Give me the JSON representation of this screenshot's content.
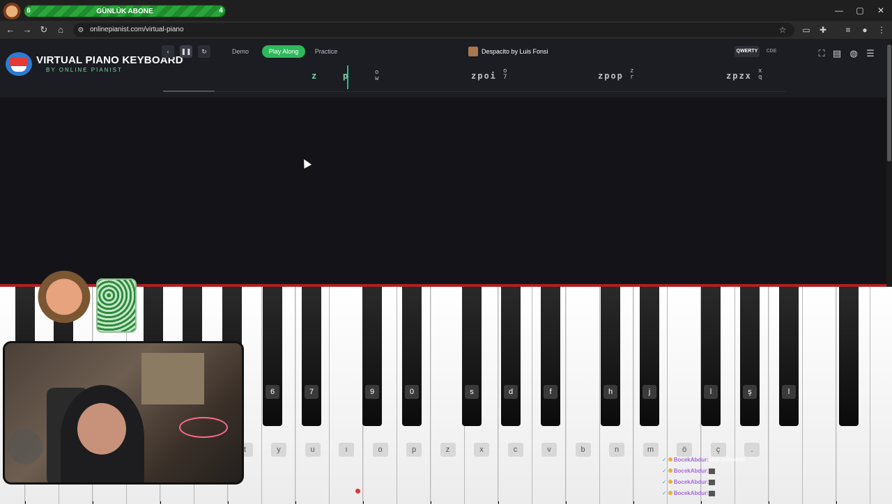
{
  "overlay": {
    "sub_goal": {
      "label": "GÜNLÜK ABONE",
      "current": "6",
      "target": "4"
    }
  },
  "browser": {
    "url": "onlinepianist.com/virtual-piano",
    "window_controls": [
      "—",
      "▢",
      "✕"
    ]
  },
  "site": {
    "logo_title": "VIRTUAL PIANO KEYBOARD",
    "logo_subtitle": "BY ONLINE PIANIST",
    "modes": [
      {
        "label": "Demo",
        "active": false
      },
      {
        "label": "Play Along",
        "active": true
      },
      {
        "label": "Practice",
        "active": false
      }
    ],
    "song_title": "Despacito by Luis Fonsi",
    "layouts": [
      {
        "label": "QWERTY",
        "active": true
      },
      {
        "label": "CDE",
        "active": false
      }
    ],
    "notes_stream": {
      "n1": "z",
      "n2": "p",
      "n3_top": "o",
      "n3_bottom": "w",
      "n4": "zpoi",
      "n4_top": "o",
      "n4_bottom": "7",
      "n5": "zpop",
      "n5_top": "z",
      "n5_bottom": "r",
      "n6": "zpzx",
      "n6_top": "x",
      "n6_bottom": "q"
    }
  },
  "piano": {
    "black_labels": [
      "6",
      "7",
      "9",
      "0",
      "s",
      "d",
      "f",
      "h",
      "j",
      "l",
      "ş",
      "l"
    ],
    "white_labels": [
      "t",
      "y",
      "u",
      "ı",
      "o",
      "p",
      "z",
      "x",
      "c",
      "v",
      "b",
      "n",
      "m",
      "ö",
      "ç",
      "."
    ]
  },
  "chat": {
    "lines": [
      {
        "user": "BocekAbdur:",
        "text": "allah kahretsin"
      },
      {
        "user": "BocekAbdur:",
        "text": ""
      },
      {
        "user": "BocekAbdur:",
        "text": ""
      },
      {
        "user": "BocekAbdur:",
        "text": ""
      }
    ]
  }
}
